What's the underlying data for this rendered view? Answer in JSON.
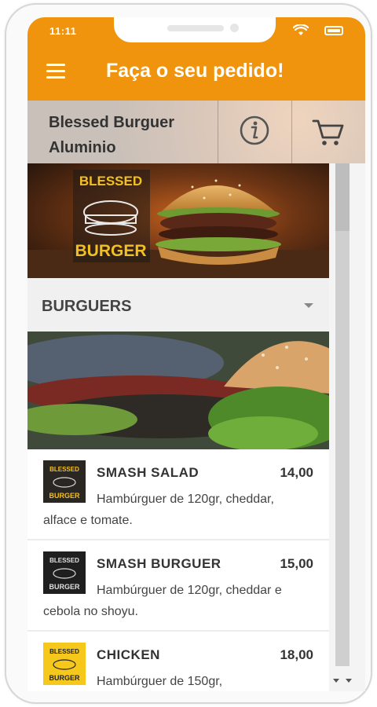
{
  "status_bar": {
    "time": "11:11",
    "wifi_icon": "wifi-icon",
    "battery_icon": "battery-icon"
  },
  "header": {
    "title": "Faça o seu pedido!",
    "menu_icon": "hamburger-menu-icon",
    "background_color": "#f0940e"
  },
  "store": {
    "name": "Blessed Burguer Aluminio",
    "info_icon": "info-icon",
    "cart_icon": "cart-icon"
  },
  "banner": {
    "logo_line1": "BLESSED",
    "logo_line2": "BURGER"
  },
  "category": {
    "label": "BURGUERS",
    "expand_icon": "caret-down-icon"
  },
  "items": [
    {
      "name": "SMASH SALAD",
      "price": "14,00",
      "description": "Hambúrguer de 120gr, cheddar, alface e tomate."
    },
    {
      "name": "SMASH BURGUER",
      "price": "15,00",
      "description": "Hambúrguer de 120gr, cheddar e cebola no shoyu."
    },
    {
      "name": "CHICKEN",
      "price": "18,00",
      "description": "Hambúrguer de 150gr,"
    }
  ],
  "colors": {
    "accent": "#f0940e",
    "text_dark": "#333333"
  }
}
